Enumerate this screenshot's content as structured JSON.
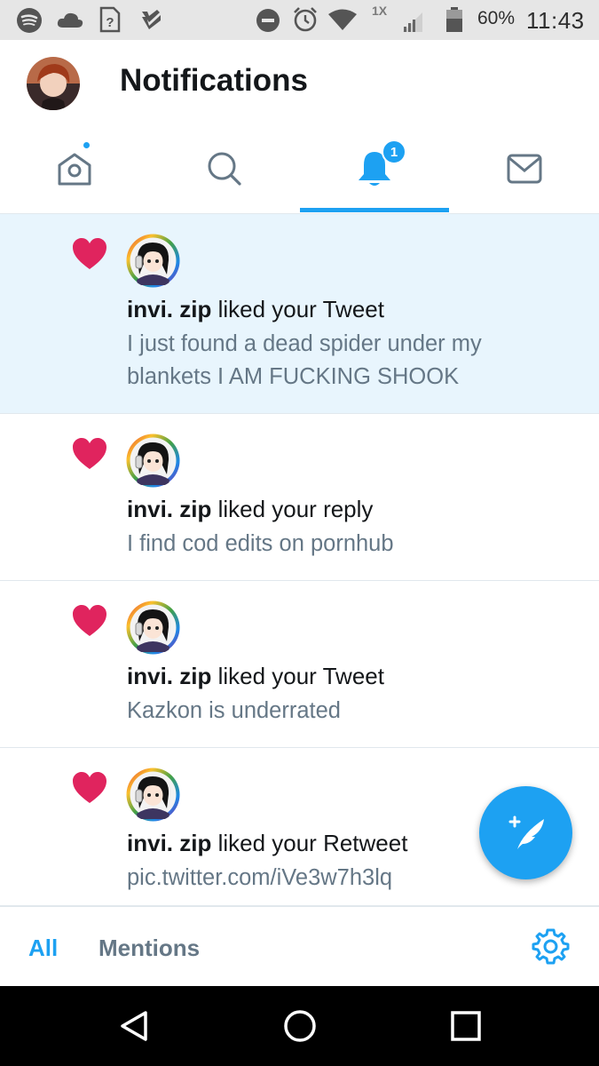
{
  "status_bar": {
    "battery_percent": "60%",
    "time": "11:43",
    "network_label": "1X"
  },
  "header": {
    "title": "Notifications"
  },
  "tabs": [
    {
      "name": "home",
      "icon": "home-icon",
      "has_dot": true
    },
    {
      "name": "search",
      "icon": "search-icon"
    },
    {
      "name": "notifications",
      "icon": "bell-icon",
      "badge": "1",
      "active": true
    },
    {
      "name": "messages",
      "icon": "mail-icon"
    }
  ],
  "notifications": [
    {
      "user": "invi. zip",
      "action": " liked your Tweet",
      "text": "I just found a dead spider under my blankets I AM FUCKING SHOOK",
      "unread": true
    },
    {
      "user": "invi. zip",
      "action": " liked your reply",
      "text": "I find cod edits on pornhub",
      "unread": false
    },
    {
      "user": "invi. zip",
      "action": " liked your Tweet",
      "text": "Kazkon is underrated",
      "unread": false
    },
    {
      "user": "invi. zip",
      "action": " liked your Retweet",
      "text": "pic.twitter.com/iVe3w7h3lq",
      "unread": false
    }
  ],
  "filters": {
    "all_label": "All",
    "mentions_label": "Mentions"
  },
  "colors": {
    "accent": "#1da1f2",
    "heart": "#e0245e",
    "unread_bg": "#e8f5fd",
    "secondary_text": "#657786"
  }
}
